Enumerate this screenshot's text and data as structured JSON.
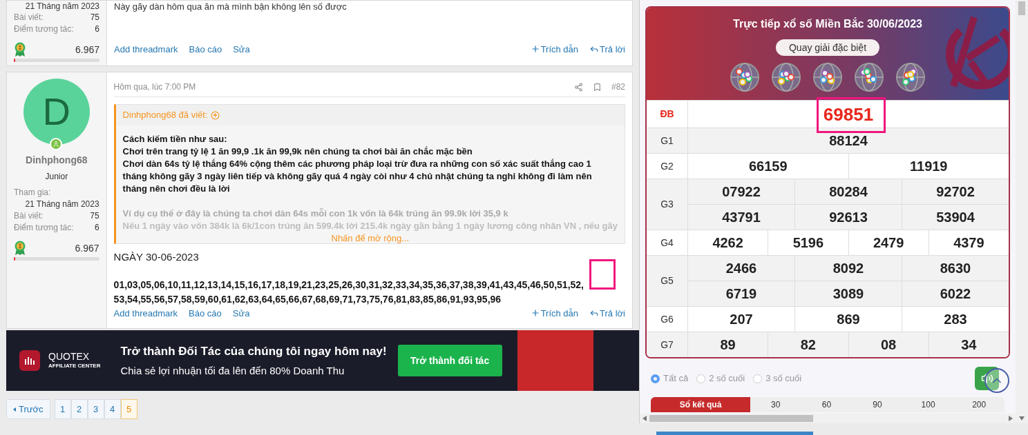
{
  "previous_post": {
    "user": {
      "join_date": "21 Tháng năm 2023",
      "stats": [
        {
          "label": "Bài viết:",
          "value": "75"
        },
        {
          "label": "Điểm tương tác:",
          "value": "6"
        }
      ],
      "points": "6.967",
      "level": 0.02
    },
    "body": "Này gãy dàn hôm qua ăn mà mình bận không lên số được",
    "actions_left": [
      "Add threadmark",
      "Báo cáo",
      "Sửa"
    ],
    "actions_right": [
      {
        "kind": "quote",
        "label": "Trích dẫn"
      },
      {
        "kind": "reply",
        "label": "Trả lời"
      }
    ]
  },
  "post": {
    "user": {
      "avatar_letter": "D",
      "name": "Dinhphong68",
      "title": "Junior",
      "join_label": "Tham gia:",
      "join_date": "21 Tháng năm 2023",
      "stats": [
        {
          "label": "Bài viết:",
          "value": "75"
        },
        {
          "label": "Điểm tương tác:",
          "value": "6"
        }
      ],
      "points": "6.967",
      "level": 0.02
    },
    "time": "Hôm qua, lúc 7:00 PM",
    "number": "#82",
    "quote": {
      "author": "Dinhphong68 đã viết:",
      "lines": [
        "Cách kiếm tiền như sau:",
        "Chơi trên trang tỷ lệ 1 ăn 99,9 .1k ăn 99,9k nên chúng ta chơi bài ăn chắc mặc bền",
        "Chơi dàn 64s tỷ lệ thắng 64% cộng thêm các phương pháp loại trừ đưa ra những con số xác suất thắng cao 1 tháng không gãy 3 ngày liên tiếp và không gãy quá 4 ngày còi như 4 chủ nhật chúng ta nghỉ không đi làm nên tháng nên chơi đều là lời"
      ],
      "faded_lines": [
        "Ví dụ cụ thể ở đây là chúng ta chơi dàn 64s mỗi con 1k vốn là 64k trúng ăn 99.9k lời 35,9 k",
        "Nếu 1 ngày vào vốn 384k là 6k/1con trúng ăn 599.4k lời 215.4k ngày gần bằng 1 ngày lương công nhân VN , nếu gãy"
      ],
      "expand": "Nhấn để mở rộng..."
    },
    "date_heading": "NGÀY 30-06-2023",
    "numbers": "01,03,05,06,10,11,12,13,14,15,16,17,18,19,21,23,25,26,30,31,32,33,34,35,36,37,38,39,41,43,45,46,50,51,52, 53,54,55,56,57,58,59,60,61,62,63,64,65,66,67,68,69,71,73,75,76,81,83,85,86,91,93,95,96",
    "actions_left": [
      "Add threadmark",
      "Báo cáo",
      "Sửa"
    ],
    "actions_right": [
      {
        "kind": "quote",
        "label": "Trích dẫn"
      },
      {
        "kind": "reply",
        "label": "Trả lời"
      }
    ]
  },
  "banner": {
    "brand": "QUOTEX",
    "brand_sub": "AFFILIATE CENTER",
    "headline": "Trở thành Đối Tác của chúng tôi ngay hôm nay!",
    "subline": "Chia sẻ lợi nhuận tối đa lên đến 80% Doanh Thu",
    "button": "Trở thành đối tác"
  },
  "pagination": {
    "prev": "Trước",
    "pages": [
      {
        "label": "1",
        "selected": false
      },
      {
        "label": "2",
        "selected": false
      },
      {
        "label": "3",
        "selected": false
      },
      {
        "label": "4",
        "selected": false
      },
      {
        "label": "5",
        "selected": true
      }
    ]
  },
  "lottery": {
    "title": "Trực tiếp xổ số Miền Bắc 30/06/2023",
    "spin_button": "Quay giải đặc biệt",
    "rows": [
      {
        "label": "ĐB",
        "special": true,
        "lines": [
          [
            "69851"
          ]
        ]
      },
      {
        "label": "G1",
        "special": false,
        "lines": [
          [
            "88124"
          ]
        ]
      },
      {
        "label": "G2",
        "special": false,
        "lines": [
          [
            "66159",
            "11919"
          ]
        ]
      },
      {
        "label": "G3",
        "special": false,
        "lines": [
          [
            "07922",
            "80284",
            "92702"
          ],
          [
            "43791",
            "92613",
            "53904"
          ]
        ]
      },
      {
        "label": "G4",
        "special": false,
        "lines": [
          [
            "4262",
            "5196",
            "2479",
            "4379"
          ]
        ]
      },
      {
        "label": "G5",
        "special": false,
        "lines": [
          [
            "2466",
            "8092",
            "8630"
          ],
          [
            "6719",
            "3089",
            "6022"
          ]
        ]
      },
      {
        "label": "G6",
        "special": false,
        "lines": [
          [
            "207",
            "869",
            "283"
          ]
        ]
      },
      {
        "label": "G7",
        "special": false,
        "lines": [
          [
            "89",
            "82",
            "08",
            "34"
          ]
        ]
      }
    ],
    "filters": [
      {
        "label": "Tất cả",
        "selected": true
      },
      {
        "label": "2 số cuối",
        "selected": false
      },
      {
        "label": "3 số cuối",
        "selected": false
      }
    ],
    "tabs": [
      {
        "label": "Sổ kết quả",
        "selected": true
      },
      {
        "label": "30",
        "selected": false
      },
      {
        "label": "60",
        "selected": false
      },
      {
        "label": "90",
        "selected": false
      },
      {
        "label": "100",
        "selected": false
      },
      {
        "label": "200",
        "selected": false
      }
    ]
  }
}
